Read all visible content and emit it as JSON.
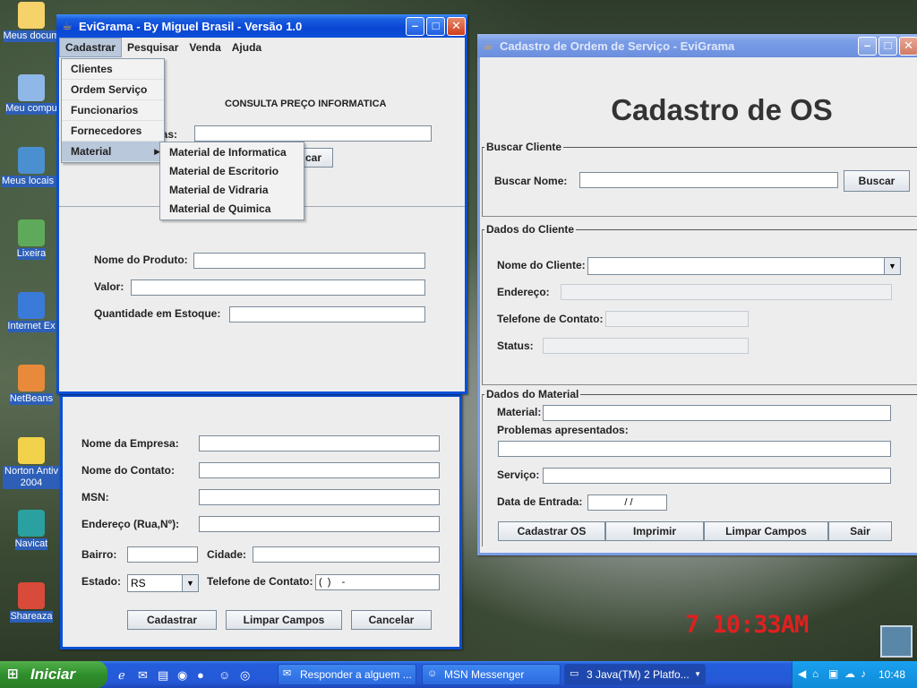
{
  "desktop": {
    "icons": [
      {
        "label": "Meus docum",
        "color": "#f5d26a"
      },
      {
        "label": "Meu compu",
        "color": "#8fb7e8"
      },
      {
        "label": "Meus locais d",
        "color": "#4a8fd0"
      },
      {
        "label": "Lixeira",
        "color": "#5faa5a"
      },
      {
        "label": "Internet Ex",
        "color": "#3a7ad8"
      },
      {
        "label": "NetBeans",
        "color": "#e88a3a"
      },
      {
        "label": "Norton Antiv 2004",
        "color": "#f2d24a"
      },
      {
        "label": "Navicat",
        "color": "#2aa0a0"
      },
      {
        "label": "Shareaza",
        "color": "#d84a3a"
      }
    ],
    "clock_overlay": "7 10:33AM"
  },
  "main_window": {
    "title": "EviGrama - By Miguel Brasil - Versão 1.0",
    "menu": [
      "Cadastrar",
      "Pesquisar",
      "Venda",
      "Ajuda"
    ],
    "cadastrar_items": [
      "Clientes",
      "Ordem Serviço",
      "Funcionarios",
      "Fornecedores",
      "Material"
    ],
    "material_submenu": [
      "Material de Informatica",
      "Material de Escritorio",
      "Material de Vidraria",
      "Material de Quimica"
    ],
    "header": "CONSULTA PREÇO INFORMATICA",
    "search_label_partial": "ras:",
    "search_button_partial": "car",
    "fields": {
      "nome_produto": "Nome do Produto:",
      "valor": "Valor:",
      "quantidade": "Quantidade em Estoque:"
    }
  },
  "supplier_window": {
    "labels": {
      "empresa": "Nome da Empresa:",
      "contato": "Nome do Contato:",
      "msn": "MSN:",
      "endereco": "Endereço (Rua,Nº):",
      "bairro": "Bairro:",
      "cidade": "Cidade:",
      "estado": "Estado:",
      "telefone": "Telefone de Contato:"
    },
    "estado_value": "RS",
    "telefone_value": "(  )    -",
    "buttons": [
      "Cadastrar",
      "Limpar Campos",
      "Cancelar"
    ]
  },
  "os_window": {
    "title": "Cadastro de Ordem de Serviço - EviGrama",
    "heading": "Cadastro de OS",
    "buscar_cliente": {
      "group": "Buscar Cliente",
      "label": "Buscar Nome:",
      "button": "Buscar"
    },
    "dados_cliente": {
      "group": "Dados do Cliente",
      "nome": "Nome do Cliente:",
      "endereco": "Endereço:",
      "telefone": "Telefone de Contato:",
      "status": "Status:"
    },
    "dados_material": {
      "group": "Dados do Material",
      "material": "Material:",
      "problemas": "Problemas apresentados:",
      "servico": "Serviço:",
      "data_entrada": "Data de Entrada:",
      "data_value": "/ /"
    },
    "buttons": [
      "Cadastrar OS",
      "Imprimir",
      "Limpar Campos",
      "Sair"
    ]
  },
  "taskbar": {
    "start": "Iniciar",
    "tasks": [
      "Responder a alguem ...",
      "MSN Messenger",
      "3 Java(TM) 2 Platfo..."
    ],
    "time": "10:48"
  }
}
